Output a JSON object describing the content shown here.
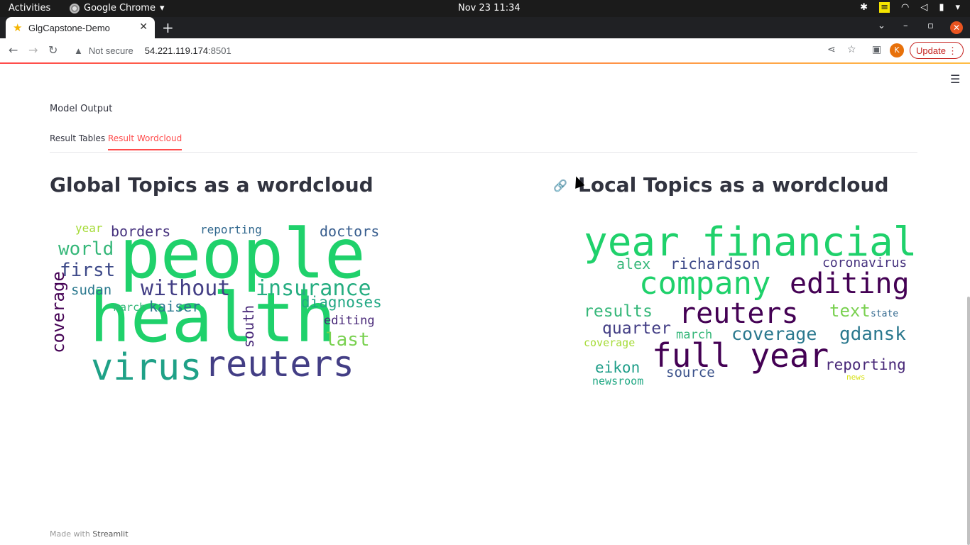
{
  "system_bar": {
    "activities": "Activities",
    "app_name": "Google Chrome",
    "clock": "Nov 23  11:34"
  },
  "browser": {
    "tab_title": "GlgCapstone-Demo",
    "security_label": "Not secure",
    "url_host": "54.221.119.174",
    "url_port": ":8501",
    "profile_initial": "K",
    "update_label": "Update"
  },
  "page": {
    "section_label": "Model Output",
    "tabs": [
      "Result Tables",
      "Result Wordcloud"
    ],
    "active_tab": "Result Wordcloud",
    "global_header": "Global Topics as a wordcloud",
    "local_header": "Local Topics as a wordcloud",
    "footer_prefix": "Made with",
    "footer_brand": "Streamlit"
  },
  "wordclouds": {
    "global": [
      {
        "text": "people",
        "color": "#1fd16b"
      },
      {
        "text": "health",
        "color": "#1fd16b"
      },
      {
        "text": "virus",
        "color": "#1fa187"
      },
      {
        "text": "reuters",
        "color": "#433e85"
      },
      {
        "text": "without",
        "color": "#433e85"
      },
      {
        "text": "insurance",
        "color": "#26ad81"
      },
      {
        "text": "world",
        "color": "#35b779"
      },
      {
        "text": "first",
        "color": "#3e4a89"
      },
      {
        "text": "sudan",
        "color": "#2a788e"
      },
      {
        "text": "kaiser",
        "color": "#2a788e"
      },
      {
        "text": "march",
        "color": "#35b779"
      },
      {
        "text": "diagnoses",
        "color": "#22a884"
      },
      {
        "text": "editing",
        "color": "#482878"
      },
      {
        "text": "last",
        "color": "#7ad151"
      },
      {
        "text": "south",
        "color": "#482878"
      },
      {
        "text": "coverage",
        "color": "#440154"
      },
      {
        "text": "year",
        "color": "#a5db36"
      },
      {
        "text": "borders",
        "color": "#46327e"
      },
      {
        "text": "reporting",
        "color": "#31688e"
      },
      {
        "text": "doctors",
        "color": "#365c8d"
      }
    ],
    "local": [
      {
        "text": "year",
        "color": "#1fd16b"
      },
      {
        "text": "financial",
        "color": "#1fd16b"
      },
      {
        "text": "alex",
        "color": "#35b779"
      },
      {
        "text": "richardson",
        "color": "#3e4a89"
      },
      {
        "text": "coronavirus",
        "color": "#46327e"
      },
      {
        "text": "company",
        "color": "#1fd16b"
      },
      {
        "text": "editing",
        "color": "#440154"
      },
      {
        "text": "results",
        "color": "#35b779"
      },
      {
        "text": "reuters",
        "color": "#440154"
      },
      {
        "text": "text",
        "color": "#7ad151"
      },
      {
        "text": "state",
        "color": "#31688e"
      },
      {
        "text": "quarter",
        "color": "#433e85"
      },
      {
        "text": "march",
        "color": "#35b779"
      },
      {
        "text": "coverage",
        "color": "#2a788e"
      },
      {
        "text": "gdansk",
        "color": "#2a788e"
      },
      {
        "text": "coverage",
        "color": "#a5db36"
      },
      {
        "text": "full year",
        "color": "#440154"
      },
      {
        "text": "reporting",
        "color": "#482878"
      },
      {
        "text": "eikon",
        "color": "#1f9e89"
      },
      {
        "text": "source",
        "color": "#3b528b"
      },
      {
        "text": "newsroom",
        "color": "#22a884"
      },
      {
        "text": "news",
        "color": "#d8e219"
      }
    ]
  }
}
